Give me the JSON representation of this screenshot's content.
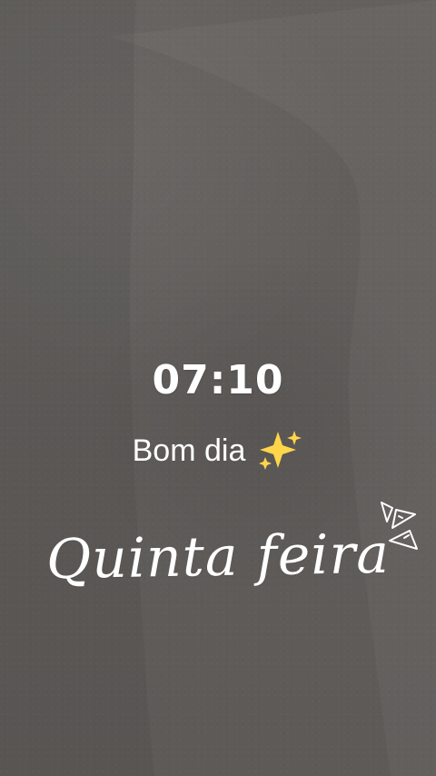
{
  "screen": {
    "time": "07:10",
    "greeting": "Bom dia",
    "day": "Quinta feira"
  },
  "icons": {
    "sparkles": "sparkles-icon",
    "doodle": "decorative-lines-icon"
  },
  "colors": {
    "background": "#625f5d",
    "text": "#ffffff",
    "sparkles": "#ffd54a"
  }
}
